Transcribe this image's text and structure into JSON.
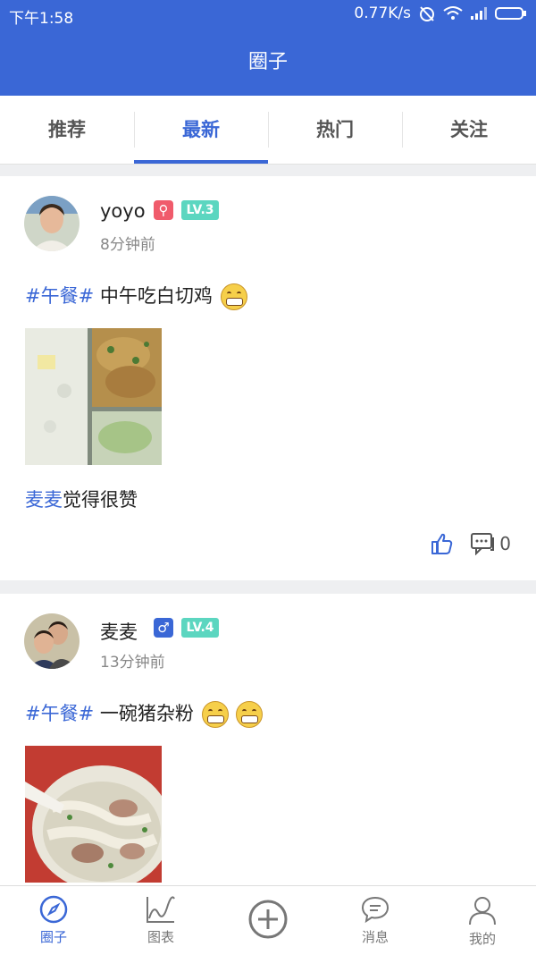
{
  "status": {
    "time": "下午1:58",
    "speed": "0.77K/s"
  },
  "appbar": {
    "title": "圈子"
  },
  "tabs": [
    {
      "label": "推荐"
    },
    {
      "label": "最新"
    },
    {
      "label": "热门"
    },
    {
      "label": "关注"
    }
  ],
  "active_tab": "最新",
  "posts": [
    {
      "username": "yoyo",
      "gender_icon": "female-icon",
      "level": "LV.3",
      "time": "8分钟前",
      "tag": "#午餐#",
      "text": " 中午吃白切鸡",
      "emoji_count": 1,
      "liker": "麦麦",
      "likes_suffix": "觉得很赞",
      "comment_count": "0"
    },
    {
      "username": "麦麦",
      "gender_icon": "male-icon",
      "level": "LV.4",
      "time": "13分钟前",
      "tag": "#午餐#",
      "text": " 一碗猪杂粉",
      "emoji_count": 2
    }
  ],
  "nav": [
    {
      "label": "圈子"
    },
    {
      "label": "图表"
    },
    {
      "label": ""
    },
    {
      "label": "消息"
    },
    {
      "label": "我的"
    }
  ],
  "colors": {
    "accent": "#3a67d6",
    "female": "#f05b6b",
    "male": "#3a67d6",
    "level": "#5cd6c0"
  }
}
